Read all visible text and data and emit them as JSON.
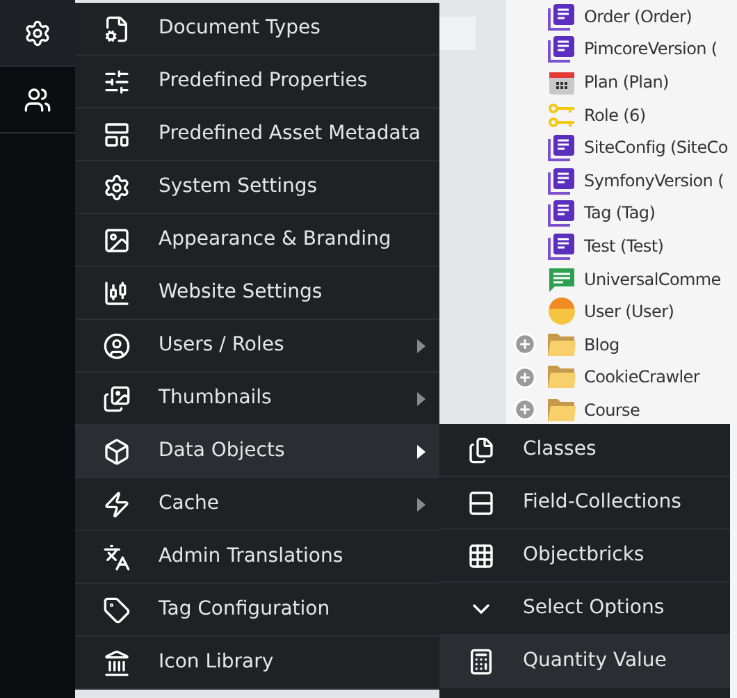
{
  "sidebar": {
    "items": [
      {
        "selected": true
      },
      {
        "selected": false
      }
    ]
  },
  "tree": {
    "rows": [
      {
        "kind": "class",
        "label": "Order (Order)"
      },
      {
        "kind": "class",
        "label": "PimcoreVersion ("
      },
      {
        "kind": "calendar",
        "label": "Plan (Plan)"
      },
      {
        "kind": "key",
        "label": "Role (6)"
      },
      {
        "kind": "class",
        "label": "SiteConfig (SiteCo"
      },
      {
        "kind": "class",
        "label": "SymfonyVersion ("
      },
      {
        "kind": "class",
        "label": "Tag (Tag)"
      },
      {
        "kind": "class",
        "label": "Test (Test)"
      },
      {
        "kind": "comment",
        "label": "UniversalComme"
      },
      {
        "kind": "user",
        "label": "User (User)"
      },
      {
        "kind": "folder",
        "label": "Blog",
        "expandable": true
      },
      {
        "kind": "folder",
        "label": "CookieCrawler",
        "expandable": true
      },
      {
        "kind": "folder",
        "label": "Course",
        "expandable": true
      }
    ]
  },
  "menu": {
    "items": [
      {
        "label": "Document Types",
        "has_submenu": false,
        "selected": false
      },
      {
        "label": "Predefined Properties",
        "has_submenu": false,
        "selected": false
      },
      {
        "label": "Predefined Asset Metadata",
        "has_submenu": false,
        "selected": false
      },
      {
        "label": "System Settings",
        "has_submenu": false,
        "selected": false
      },
      {
        "label": "Appearance & Branding",
        "has_submenu": false,
        "selected": false
      },
      {
        "label": "Website Settings",
        "has_submenu": false,
        "selected": false
      },
      {
        "label": "Users / Roles",
        "has_submenu": true,
        "selected": false
      },
      {
        "label": "Thumbnails",
        "has_submenu": true,
        "selected": false
      },
      {
        "label": "Data Objects",
        "has_submenu": true,
        "selected": true
      },
      {
        "label": "Cache",
        "has_submenu": true,
        "selected": false
      },
      {
        "label": "Admin Translations",
        "has_submenu": false,
        "selected": false
      },
      {
        "label": "Tag Configuration",
        "has_submenu": false,
        "selected": false
      },
      {
        "label": "Icon Library",
        "has_submenu": false,
        "selected": false
      }
    ]
  },
  "submenu": {
    "items": [
      {
        "label": "Classes",
        "selected": false
      },
      {
        "label": "Field-Collections",
        "selected": false
      },
      {
        "label": "Objectbricks",
        "selected": false
      },
      {
        "label": "Select Options",
        "selected": false
      },
      {
        "label": "Quantity Value",
        "selected": true
      }
    ]
  }
}
